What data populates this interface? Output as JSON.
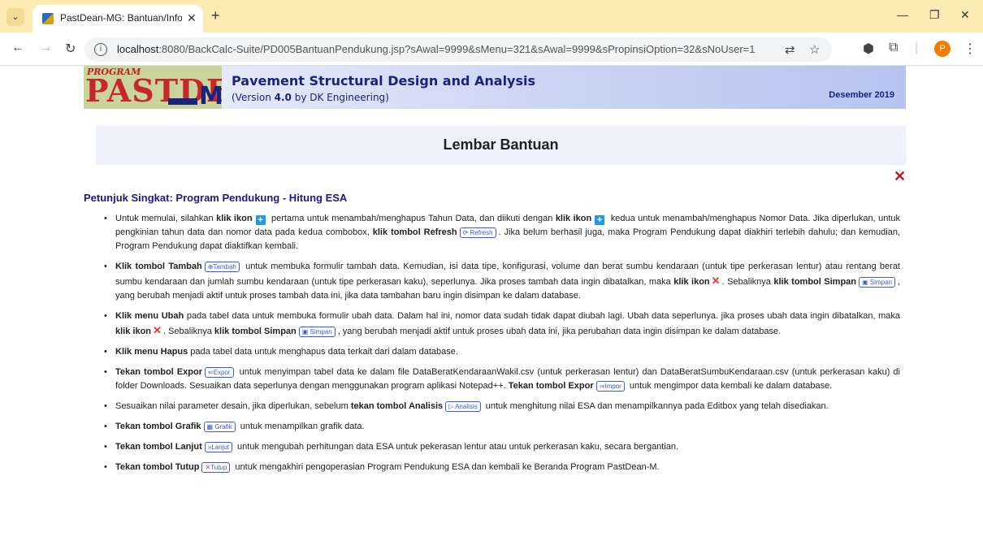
{
  "browser": {
    "tab_title": "PastDean-MG: Bantuan/Informa",
    "url_host": "localhost",
    "url_rest": ":8080/BackCalc-Suite/PD005BantuanPendukung.jsp?sAwal=9999&sMenu=321&sAwal=9999&sPropinsiOption=32&sNoUser=1",
    "profile_initial": "P"
  },
  "banner": {
    "logo_small": "PROGRAM",
    "logo_big": "PASTDEAN",
    "logo_m": "M",
    "title": "Pavement Structural Design and Analysis",
    "version_prefix": "(Version ",
    "version_num": "4.0",
    "version_suffix": " by DK Engineering)",
    "date": "Desember 2019"
  },
  "page_title": "Lembar Bantuan",
  "section_title": "Petunjuk Singkat: Program Pendukung - Hitung ESA",
  "buttons": {
    "refresh": "Refresh",
    "tambah": "Tambah",
    "simpan": "Simpan",
    "expor": "Expor",
    "impor": "Impor",
    "analisis": "Analisis",
    "grafik": "Grafik",
    "lanjut": "Lanjut",
    "tutup": "Tutup"
  },
  "items": {
    "i1": {
      "a": "Untuk memulai, silahkan ",
      "b": "klik ikon",
      "c": " pertama untuk menambah/menghapus Tahun Data, dan diikuti dengan ",
      "d": "klik ikon",
      "e": " kedua untuk menambah/menghapus Nomor Data. Jika diperlukan, untuk pengkinian tahun data dan nomor data pada kedua combobox, ",
      "f": "klik tombol Refresh",
      "g": ". Jika belum berhasil juga, maka Program Pendukung dapat diakhiri terlebih dahulu; dan kemudian, Program Pendukung dapat diaktifkan kembali."
    },
    "i2": {
      "a": "Klik tombol Tambah",
      "b": " untuk membuka formulir tambah data. Kemudian, isi data tipe, konfigurasi, volume dan berat sumbu kendaraan (untuk tipe perkerasan lentur) atau rentang berat sumbu kendaraan dan jumlah sumbu kendaraan (untuk tipe perkerasan kaku), seperlunya. Jika proses tambah data ingin dibatalkan, maka ",
      "c": "klik ikon",
      "d": ". Sebaliknya ",
      "e": "klik tombol Simpan",
      "f": ", yang berubah menjadi aktif untuk proses tambah data ini, jika data tambahan baru ingin disimpan ke dalam database."
    },
    "i3": {
      "a": "Klik menu Ubah",
      "b": " pada tabel data untuk membuka formulir ubah data. Dalam hal ini, nomor data sudah tidak dapat diubah lagi. Ubah data seperlunya. jika proses ubah data ingin dibatalkan, maka ",
      "c": "klik ikon",
      "d": ". Sebaliknya ",
      "e": "klik tombol Simpan",
      "f": ", yang berubah menjadi aktif untuk proses ubah data ini, jika perubahan data ingin disimpan ke dalam database."
    },
    "i4": {
      "a": "Klik menu Hapus",
      "b": " pada tabel data untuk menghapus data terkait dari dalam database."
    },
    "i5": {
      "a": "Tekan tombol Expor",
      "b": " untuk menyimpan tabel data ke dalam file DataBeratKendaraanWakil.csv (untuk perkerasan lentur) dan DataBeratSumbuKendaraan.csv (untuk perkerasan kaku) di folder Downloads. Sesuaikan data seperlunya dengan menggunakan program aplikasi Notepad++. ",
      "c": "Tekan tombol Expor",
      "d": " untuk mengimpor data kembali ke dalam database."
    },
    "i6": {
      "a": "Sesuaikan nilai parameter desain, jika diperlukan, sebelum ",
      "b": "tekan tombol Analisis",
      "c": " untuk menghitung nilai ESA dan menampilkannya pada Editbox yang telah disediakan."
    },
    "i7": {
      "a": "Tekan tombol Grafik",
      "b": " untuk menampilkan grafik data."
    },
    "i8": {
      "a": "Tekan tombol Lanjut",
      "b": " untuk mengubah perhitungan data ESA untuk pekerasan lentur atau untuk perkerasan kaku, secara bergantian."
    },
    "i9": {
      "a": "Tekan tombol Tutup",
      "b": " untuk mengakhiri pengoperasian Program Pendukung ESA dan kembali ke Beranda Program PastDean-M."
    }
  }
}
